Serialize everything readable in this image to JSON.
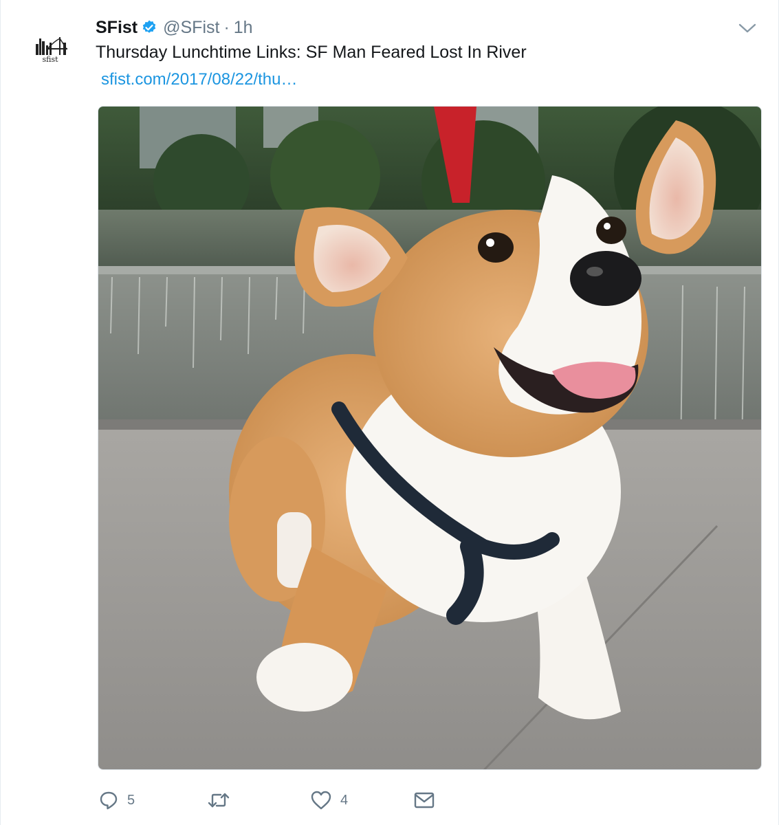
{
  "account": {
    "name": "SFist",
    "handle": "@SFist",
    "separator": "·",
    "time": "1h",
    "avatar_wordmark": "sfist",
    "verified_color": "#1da1f2"
  },
  "tweet": {
    "text": "Thursday Lunchtime Links: SF Man Feared Lost In River",
    "link": "sfist.com/2017/08/22/thu…",
    "image_subject": "corgi puppy on leash by fountain"
  },
  "actions": {
    "reply_count": "5",
    "retweet_count": "",
    "like_count": "4",
    "icons": [
      "reply-icon",
      "retweet-icon",
      "like-icon",
      "message-icon"
    ]
  },
  "colors": {
    "link": "#1b95e0",
    "muted": "#657786",
    "text": "#14171a"
  }
}
